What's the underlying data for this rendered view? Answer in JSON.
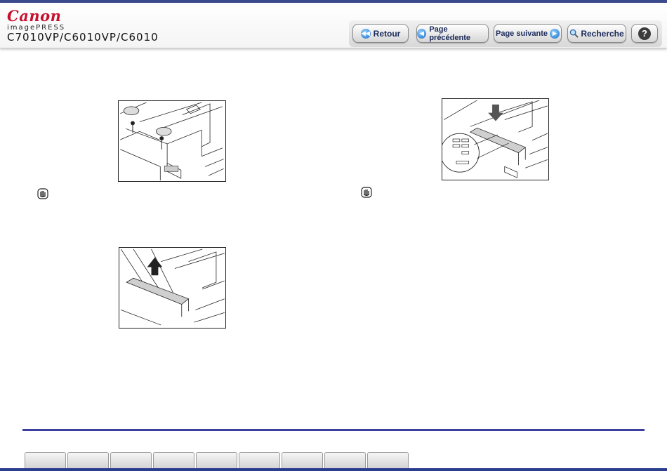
{
  "header": {
    "brand": "Canon",
    "product": "imagePRESS",
    "model": "C7010VP/C6010VP/C6010"
  },
  "toolbar": {
    "back_label": "Retour",
    "prev_label": "Page précédente",
    "next_label": "Page suivante",
    "search_label": "Recherche",
    "help_label": "?"
  },
  "colors": {
    "brand_red": "#c8102e",
    "accent_blue": "#3c3fa0",
    "button_text": "#1a2a5a"
  },
  "icons": [
    "rewind-icon",
    "arrow-left-icon",
    "arrow-right-icon",
    "magnifier-icon",
    "question-icon",
    "caution-hand-icon"
  ],
  "footer": {
    "tab_count": 9
  }
}
